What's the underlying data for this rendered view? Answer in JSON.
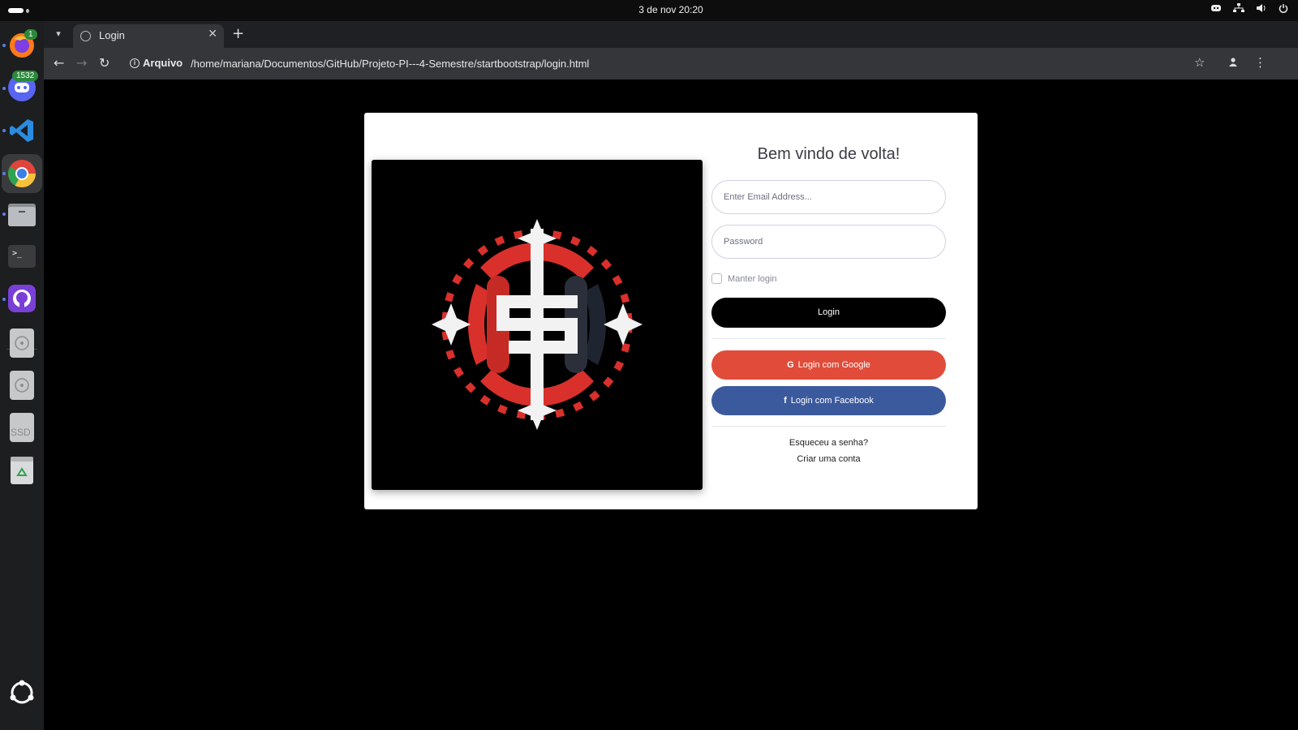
{
  "system": {
    "clock": "3 de nov  20:20"
  },
  "dock": {
    "items": [
      {
        "name": "firefox",
        "badge": "1"
      },
      {
        "name": "discord",
        "badge": "1532"
      },
      {
        "name": "vscode"
      },
      {
        "name": "chrome"
      },
      {
        "name": "files"
      },
      {
        "name": "terminal"
      },
      {
        "name": "github-desktop"
      },
      {
        "name": "disk-1"
      },
      {
        "name": "disk-2"
      },
      {
        "name": "ssd",
        "label": "SSD"
      },
      {
        "name": "trash"
      }
    ]
  },
  "browser": {
    "tab_title": "Login",
    "address_scheme_label": "Arquivo",
    "url": "/home/mariana/Documentos/GitHub/Projeto-PI---4-Semestre/startbootstrap/login.html"
  },
  "login": {
    "heading": "Bem vindo de volta!",
    "email_placeholder": "Enter Email Address...",
    "password_placeholder": "Password",
    "remember_label": "Manter login",
    "login_button": "Login",
    "google_button": "Login com Google",
    "facebook_button": "Login com Facebook",
    "forgot_link": "Esqueceu a senha?",
    "create_link": "Criar uma conta"
  },
  "colors": {
    "google": "#e14c3a",
    "facebook": "#3b5a9e",
    "login": "#000000",
    "logo_red": "#d9302b"
  }
}
